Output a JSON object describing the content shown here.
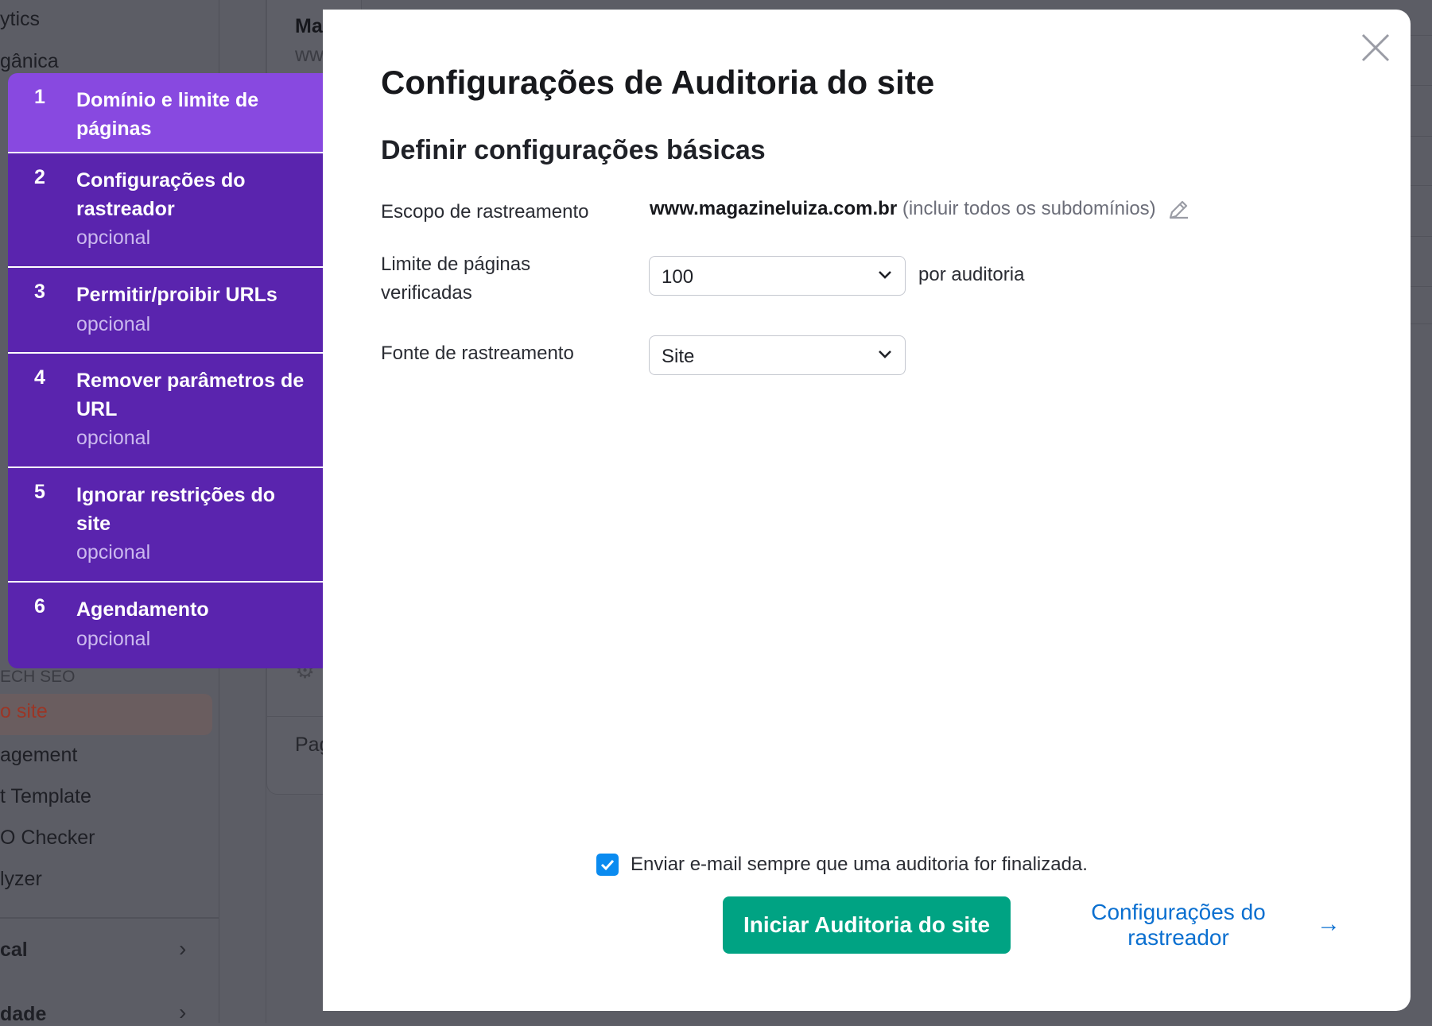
{
  "background": {
    "sidebar": {
      "items": [
        "ytics",
        "gânica",
        "o site",
        "agement",
        "t Template",
        "O Checker",
        "lyzer"
      ],
      "section_label": "ECH SEO",
      "groups": [
        "cal",
        "dade"
      ]
    },
    "card": {
      "title": "Ma",
      "subtitle": "ww",
      "footer": "Pag"
    }
  },
  "steps": [
    {
      "number": "1",
      "label": "Domínio e limite de páginas",
      "optional": "",
      "active": true
    },
    {
      "number": "2",
      "label": "Configurações do rastreador",
      "optional": "opcional",
      "active": false
    },
    {
      "number": "3",
      "label": "Permitir/proibir URLs",
      "optional": "opcional",
      "active": false
    },
    {
      "number": "4",
      "label": "Remover parâmetros de URL",
      "optional": "opcional",
      "active": false
    },
    {
      "number": "5",
      "label": "Ignorar restrições do site",
      "optional": "opcional",
      "active": false
    },
    {
      "number": "6",
      "label": "Agendamento",
      "optional": "opcional",
      "active": false
    }
  ],
  "modal": {
    "title": "Configurações de Auditoria do site",
    "subtitle": "Definir configurações básicas",
    "scope_label": "Escopo de rastreamento",
    "scope_domain": "www.magazineluiza.com.br",
    "scope_hint": "(incluir todos os subdomínios)",
    "limit_label": "Limite de páginas verificadas",
    "limit_value": "100",
    "limit_suffix": "por auditoria",
    "source_label": "Fonte de rastreamento",
    "source_value": "Site",
    "email_checkbox_label": "Enviar e-mail sempre que uma auditoria for finalizada.",
    "email_checked": true,
    "start_button": "Iniciar Auditoria do site",
    "next_link": "Configurações do rastreador"
  },
  "colors": {
    "step_active": "#8849e0",
    "step_bg": "#5a24ae",
    "primary_button": "#00a383",
    "link": "#0a6fd0",
    "checkbox": "#0a8bf0"
  }
}
